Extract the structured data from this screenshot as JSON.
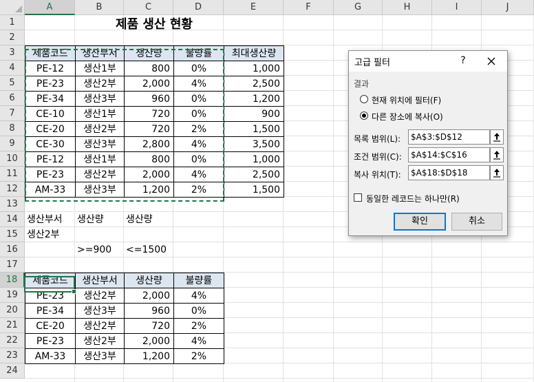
{
  "columns": [
    "A",
    "B",
    "C",
    "D",
    "E",
    "F",
    "G",
    "H",
    "I",
    "J"
  ],
  "rows": [
    "1",
    "2",
    "3",
    "4",
    "5",
    "6",
    "7",
    "8",
    "9",
    "10",
    "11",
    "12",
    "13",
    "14",
    "15",
    "16",
    "17",
    "18",
    "19",
    "20",
    "21",
    "22",
    "23",
    "24"
  ],
  "title": "제품 생산 현황",
  "source_table": {
    "headers": [
      "제품코드",
      "생산부서",
      "생산량",
      "불량률",
      "최대생산량"
    ],
    "rows": [
      [
        "PE-12",
        "생산1부",
        "800",
        "0%",
        "1,000"
      ],
      [
        "PE-23",
        "생산2부",
        "2,000",
        "4%",
        "2,500"
      ],
      [
        "PE-34",
        "생산3부",
        "960",
        "0%",
        "1,200"
      ],
      [
        "CE-10",
        "생산1부",
        "720",
        "0%",
        "900"
      ],
      [
        "CE-20",
        "생산2부",
        "720",
        "2%",
        "1,500"
      ],
      [
        "CE-30",
        "생산3부",
        "2,800",
        "4%",
        "3,500"
      ],
      [
        "PE-12",
        "생산1부",
        "800",
        "0%",
        "1,000"
      ],
      [
        "PE-23",
        "생산2부",
        "2,000",
        "4%",
        "2,500"
      ],
      [
        "AM-33",
        "생산3부",
        "1,200",
        "2%",
        "1,500"
      ]
    ]
  },
  "criteria": {
    "headers": [
      "생산부서",
      "생산량",
      "생산량"
    ],
    "row1": [
      "생산2부",
      "",
      ""
    ],
    "row2": [
      "",
      ">=900",
      "<=1500"
    ]
  },
  "result_table": {
    "headers": [
      "제품코드",
      "생산부서",
      "생산량",
      "불량률"
    ],
    "rows": [
      [
        "PE-23",
        "생산2부",
        "2,000",
        "4%"
      ],
      [
        "PE-34",
        "생산3부",
        "960",
        "0%"
      ],
      [
        "CE-20",
        "생산2부",
        "720",
        "2%"
      ],
      [
        "PE-23",
        "생산2부",
        "2,000",
        "4%"
      ],
      [
        "AM-33",
        "생산3부",
        "1,200",
        "2%"
      ]
    ]
  },
  "dialog": {
    "title": "고급 필터",
    "help": "?",
    "result_group": "결과",
    "opt_inplace": "현재 위치에 필터(F)",
    "opt_copy": "다른 장소에 복사(O)",
    "list_range_label": "목록 범위(L):",
    "list_range_value": "$A$3:$D$12",
    "criteria_range_label": "조건 범위(C):",
    "criteria_range_value": "$A$14:$C$16",
    "copy_to_label": "복사 위치(T):",
    "copy_to_value": "$A$18:$D$18",
    "unique_label": "동일한 레코드는 하나만(R)",
    "ok": "확인",
    "cancel": "취소"
  },
  "colors": {
    "accent": "#217346",
    "header_fill": "#dce6f1",
    "dialog_button": "#0078d7"
  }
}
